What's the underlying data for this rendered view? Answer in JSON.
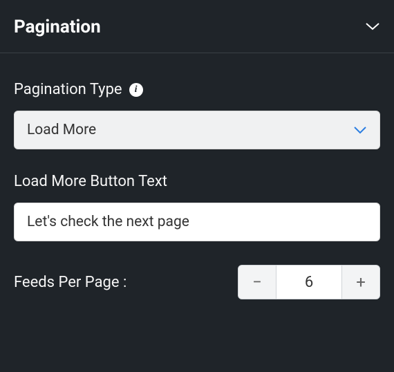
{
  "panel": {
    "title": "Pagination"
  },
  "fields": {
    "paginationType": {
      "label": "Pagination Type",
      "value": "Load More"
    },
    "buttonText": {
      "label": "Load More Button Text",
      "value": "Let's check the next page"
    },
    "feedsPerPage": {
      "label": "Feeds Per Page :",
      "value": "6"
    }
  }
}
